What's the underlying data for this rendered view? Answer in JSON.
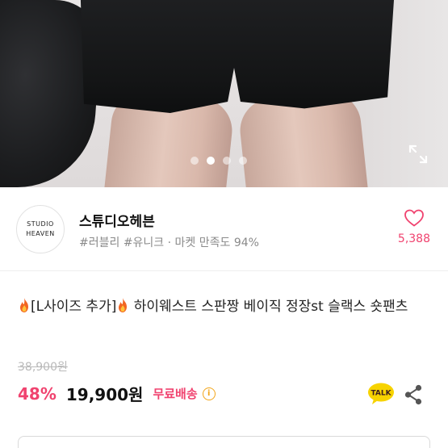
{
  "gallery": {
    "slide_count": 4,
    "active_index": 1
  },
  "shop": {
    "logo_line1": "STUDIO",
    "logo_line2": "HEAVEN",
    "name": "스튜디오헤븐",
    "tags": "#러블리 #유니크 · 마켓 만족도 94%",
    "like_count": "5,388"
  },
  "product": {
    "title_part1": "[L사이즈 추가]",
    "title_part2": " 하이웨스트 스판짱 베이직 정장st 슬랙스 숏팬츠",
    "original_price": "38,900원",
    "discount": "48%",
    "price": "19,900원",
    "shipping": "무료배송",
    "info_glyph": "i"
  },
  "actions": {
    "talk_label": "TALK"
  },
  "colors": {
    "accent": "#f0436f",
    "talk_bg": "#f7d300",
    "info": "#f2a51a"
  },
  "icons": [
    "fire-icon",
    "heart-icon",
    "expand-icon",
    "info-icon",
    "kakao-talk-icon",
    "share-icon"
  ]
}
